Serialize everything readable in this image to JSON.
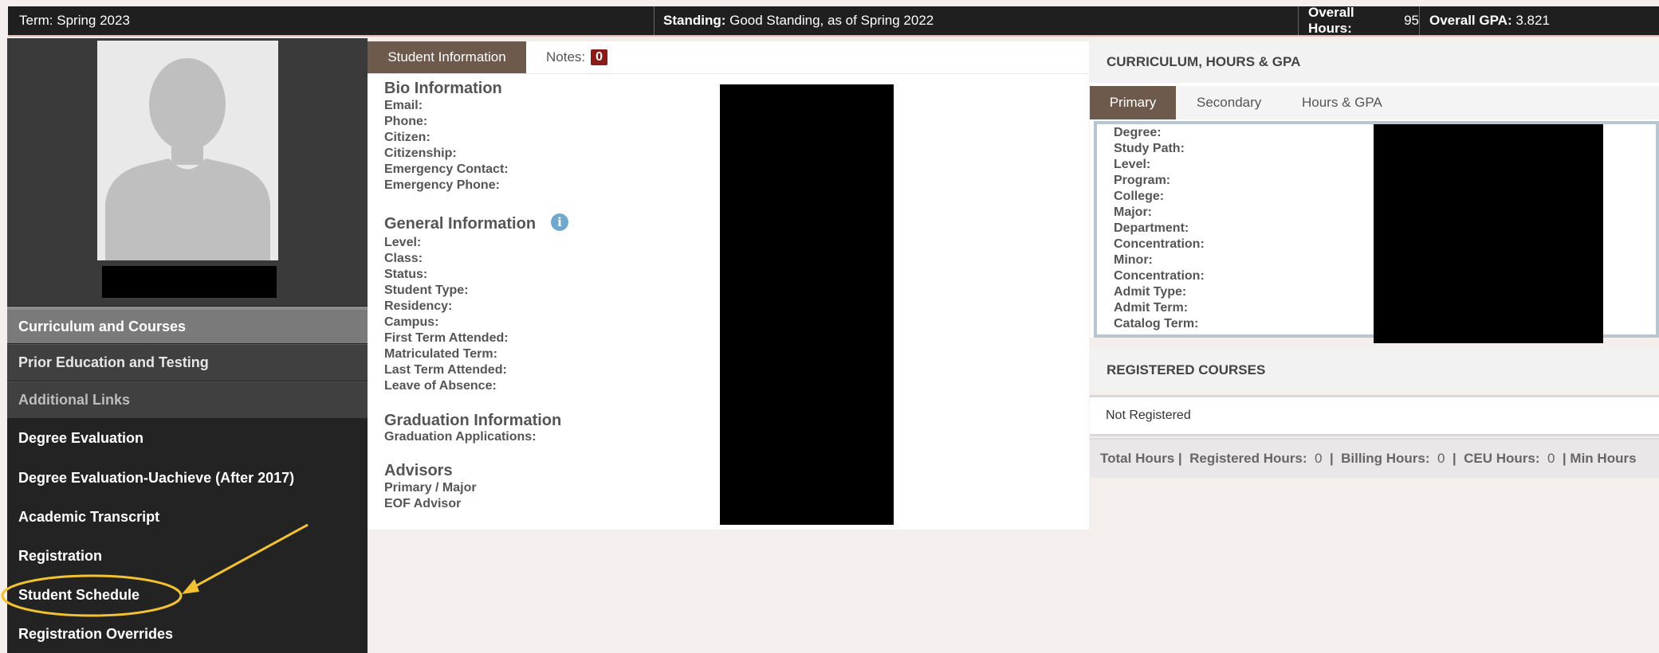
{
  "topbar": {
    "term_label": "Term:",
    "term_value": "Spring 2023",
    "standing_label": "Standing:",
    "standing_value": "Good Standing, as of Spring 2022",
    "hours_label": "Overall Hours:",
    "hours_value": "95",
    "gpa_label": "Overall GPA:",
    "gpa_value": "3.821"
  },
  "sidebar": {
    "photo_icon": "person-silhouette-icon",
    "items": [
      {
        "label": "Curriculum and Courses"
      },
      {
        "label": "Prior Education and Testing"
      },
      {
        "label": "Additional Links"
      },
      {
        "label": "Degree Evaluation"
      },
      {
        "label": "Degree Evaluation-Uachieve (After 2017)"
      },
      {
        "label": "Academic Transcript"
      },
      {
        "label": "Registration"
      },
      {
        "label": "Student Schedule"
      },
      {
        "label": "Registration Overrides"
      }
    ],
    "annotation_color": "#f2c230"
  },
  "info": {
    "tab_student": "Student Information",
    "tab_notes": "Notes:",
    "notes_count": "0",
    "bio_title": "Bio Information",
    "bio_fields": [
      "Email:",
      "Phone:",
      "Citizen:",
      "Citizenship:",
      "Emergency Contact:",
      "Emergency Phone:"
    ],
    "general_title": "General Information",
    "info_icon": "i",
    "general_fields": [
      "Level:",
      "Class:",
      "Status:",
      "Student Type:",
      "Residency:",
      "Campus:",
      "First Term Attended:",
      "Matriculated Term:",
      "Last Term Attended:",
      "Leave of Absence:"
    ],
    "grad_title": "Graduation Information",
    "grad_fields": [
      "Graduation Applications:"
    ],
    "advisors_title": "Advisors",
    "advisor_fields": [
      "Primary / Major",
      "EOF Advisor"
    ]
  },
  "curriculum": {
    "title": "CURRICULUM, HOURS & GPA",
    "tabs": [
      "Primary",
      "Secondary",
      "Hours & GPA"
    ],
    "fields": [
      "Degree:",
      "Study Path:",
      "Level:",
      "Program:",
      "College:",
      "Major:",
      "Department:",
      "Concentration:",
      "Minor:",
      "Concentration:",
      "Admit Type:",
      "Admit Term:",
      "Catalog Term:"
    ]
  },
  "registered": {
    "title": "REGISTERED COURSES",
    "status": "Not Registered",
    "footer": {
      "total": "Total Hours |",
      "reg_label": "Registered Hours:",
      "reg_value": "0",
      "bill_label": "Billing Hours:",
      "bill_value": "0",
      "ceu_label": "CEU Hours:",
      "ceu_value": "0",
      "min_label": "Min Hours"
    }
  },
  "colors": {
    "topbar_bg": "#1f1f1f",
    "tab_active": "#6d5a4c",
    "badge": "#8b1a1a",
    "info_icon": "#6fa8cc"
  }
}
